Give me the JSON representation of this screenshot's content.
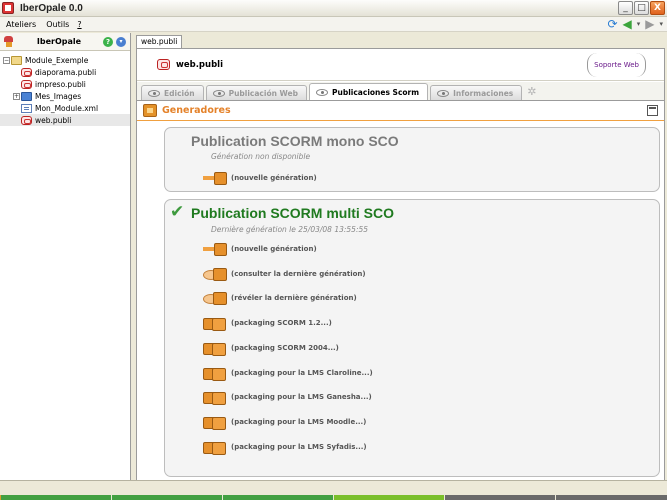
{
  "window": {
    "title": "IberOpale 0.0",
    "buttons": [
      "_",
      "□",
      "X"
    ]
  },
  "menu": {
    "items": [
      "Ateliers",
      "Outils",
      "?"
    ],
    "toolbar_icons": [
      "sync-icon",
      "back-arrow-icon",
      "dropdown-arrow-icon",
      "forward-arrow-icon",
      "dropdown-arrow-icon"
    ]
  },
  "left_panel": {
    "title": "IberOpale",
    "help_label": "?",
    "menu_label": "▾",
    "tree": [
      {
        "label": "Module_Exemple",
        "toggle": "−",
        "icon": "folder-open",
        "level": 0
      },
      {
        "label": "diaporama.publi",
        "icon": "publi",
        "level": 1
      },
      {
        "label": "impreso.publi",
        "icon": "publi",
        "level": 1
      },
      {
        "label": "Mes_Images",
        "toggle": "+",
        "icon": "folder",
        "level": 1
      },
      {
        "label": "Mon_Module.xml",
        "icon": "xml",
        "level": 1
      },
      {
        "label": "web.publi",
        "icon": "publi",
        "level": 1,
        "selected": true
      }
    ]
  },
  "editor": {
    "doc_tab": "web.publi",
    "doc_title": "web.publi",
    "support_link": "Soporte Web",
    "tabs": [
      {
        "label": "Edición",
        "active": false
      },
      {
        "label": "Publicación Web",
        "active": false
      },
      {
        "label": "Publicaciones Scorm",
        "active": true
      },
      {
        "label": "Informaciones",
        "active": false
      }
    ],
    "add_tab": "✲"
  },
  "generators": {
    "header": "Generadores",
    "box1": {
      "title": "Publication SCORM mono SCO",
      "status": "Génération non disponible",
      "actions": [
        "(nouvelle génération)"
      ]
    },
    "box2": {
      "title": "Publication SCORM multi SCO",
      "check": "✔",
      "status": "Dernière génération le 25/03/08 13:55:55",
      "actions": [
        {
          "label": "(nouvelle génération)",
          "icon": "new"
        },
        {
          "label": "(consulter la dernière génération)",
          "icon": "view"
        },
        {
          "label": "(révéler la dernière génération)",
          "icon": "view"
        },
        {
          "label": "(packaging SCORM 1.2...)",
          "icon": "pack"
        },
        {
          "label": "(packaging SCORM 2004...)",
          "icon": "pack"
        },
        {
          "label": "(packaging pour la LMS Claroline...)",
          "icon": "pack"
        },
        {
          "label": "(packaging pour la LMS Ganesha...)",
          "icon": "pack"
        },
        {
          "label": "(packaging pour la LMS Moodle...)",
          "icon": "pack"
        },
        {
          "label": "(packaging pour la LMS Syfadis...)",
          "icon": "pack"
        }
      ]
    }
  },
  "colors": {
    "accent_orange": "#e4822a",
    "success_green": "#1f7a1f",
    "taskbar_segments": [
      "#d8a030",
      "#42a042",
      "#42a042",
      "#7abf2a",
      "#6a6a6a",
      "#6a6a6a"
    ]
  }
}
